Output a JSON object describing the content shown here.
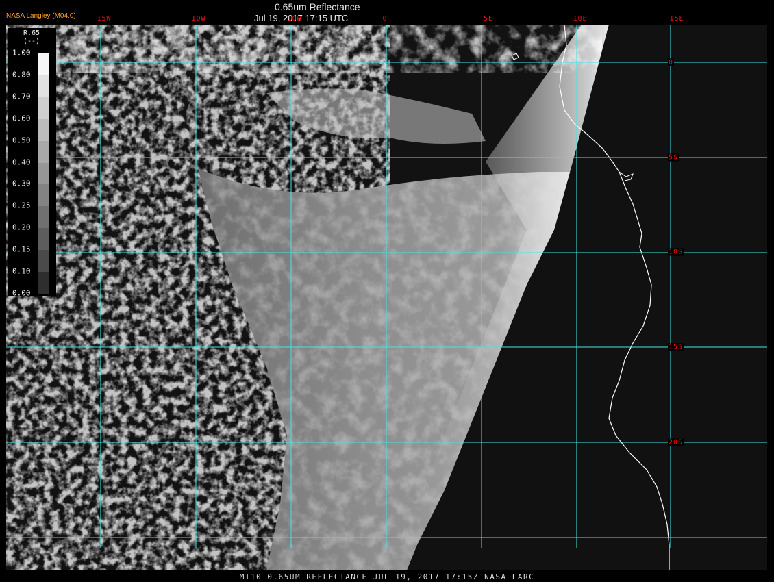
{
  "header": {
    "product_title": "0.65um Reflectance",
    "datetime": "Jul 19, 2017 17:15 UTC",
    "credit": "NASA Langley (M04.0)"
  },
  "footer": {
    "caption": "MT10  0.65UM REFLECTANCE   JUL 19, 2017 17:15Z   NASA LARC"
  },
  "legend": {
    "title": "R.65",
    "units": "(--)",
    "tick_labels": [
      "1.00",
      "0.80",
      "0.70",
      "0.60",
      "0.50",
      "0.40",
      "0.30",
      "0.25",
      "0.20",
      "0.15",
      "0.10",
      "0.00"
    ],
    "ramp_grays": [
      "#f6f6f6",
      "#e2e2e2",
      "#cfcfcf",
      "#bcbcbc",
      "#a9a9a9",
      "#969696",
      "#838383",
      "#707070",
      "#5d5d5d",
      "#4a4a4a",
      "#2e2e2e"
    ]
  },
  "map": {
    "grid_color": "#3ee6e6",
    "coast_color": "#ffffff",
    "longitude_labels": [
      "15W",
      "10W",
      "0",
      "5E",
      "10E",
      "15E"
    ],
    "latitude_labels": [
      "0",
      "5S",
      "10S",
      "15S",
      "20S"
    ],
    "extra_lon_label": "10W"
  }
}
